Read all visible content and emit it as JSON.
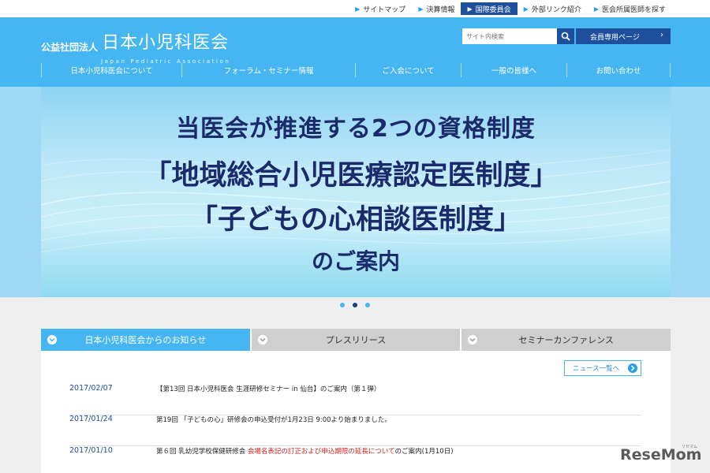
{
  "top_links": [
    {
      "label": "サイトマップ",
      "active": false
    },
    {
      "label": "決算情報",
      "active": false
    },
    {
      "label": "国際委員会",
      "active": true
    },
    {
      "label": "外部リンク紹介",
      "active": false
    },
    {
      "label": "医会所属医師を探す",
      "active": false
    }
  ],
  "header": {
    "org_type": "公益社団法人",
    "org_name": "日本小児科医会",
    "org_name_en": "Japan Pediatric Association",
    "search_placeholder": "サイト内検索",
    "member_button": "会員専用ページ"
  },
  "nav": [
    {
      "label": "日本小児科医会について"
    },
    {
      "label": "フォーラム・セミナー情報"
    },
    {
      "label": "ご入会について"
    },
    {
      "label": "一般の皆様へ"
    },
    {
      "label": "お問い合わせ"
    }
  ],
  "hero": {
    "line1": "当医会が推進する2つの資格制度",
    "line2": "「地域総合小児医療認定医制度」",
    "line3": "「子どもの心相談医制度」",
    "line4": "のご案内",
    "slides": 3,
    "active_slide": 2
  },
  "tabs": [
    {
      "label": "日本小児科医会からのお知らせ",
      "active": true
    },
    {
      "label": "プレスリリース",
      "active": false
    },
    {
      "label": "セミナーカンファレンス",
      "active": false
    }
  ],
  "news_list_button": "ニュース一覧へ",
  "news": [
    {
      "date": "2017/02/07",
      "title": "【第13回 日本小児科医会 生涯研修セミナー in 仙台】のご案内（第１弾）",
      "highlight": "",
      "title_after": ""
    },
    {
      "date": "2017/01/24",
      "title": "第19回 「子どもの心」研修会の申込受付が1月23日 9:00より始まりました。",
      "highlight": "",
      "title_after": ""
    },
    {
      "date": "2017/01/10",
      "title": "第６回 乳幼児学校保健研修会 ",
      "highlight": "会場名表記の訂正および申込期限の延長について",
      "title_after": "のご案内(1月10日)"
    }
  ],
  "watermark": {
    "text": "ReseMom",
    "sub": "リセマム"
  },
  "colors": {
    "header_blue": "#46b6f3",
    "navy": "#1d4f9c",
    "hero_text": "#1a2a6b",
    "highlight_red": "#d42020"
  }
}
